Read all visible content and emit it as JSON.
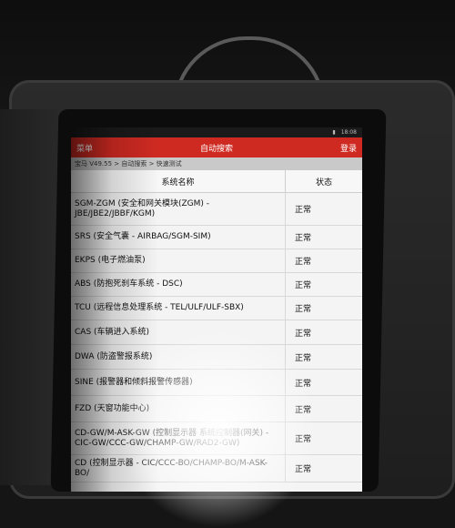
{
  "header": {
    "menu_label": "菜单",
    "title": "自动搜索",
    "login_label": "登录"
  },
  "statusbar": {
    "time": "18:08"
  },
  "breadcrumb": "宝马 V49.55 > 自动搜索 > 快速测试",
  "table": {
    "columns": [
      "系统名称",
      "状态"
    ],
    "rows": [
      {
        "name": "SGM-ZGM (安全和网关模块(ZGM) - JBE/JBE2/JBBF/KGM)",
        "status": "正常"
      },
      {
        "name": "SRS (安全气囊 - AIRBAG/SGM-SIM)",
        "status": "正常"
      },
      {
        "name": "EKPS (电子燃油泵)",
        "status": "正常"
      },
      {
        "name": "ABS (防抱死刹车系统 - DSC)",
        "status": "正常"
      },
      {
        "name": "TCU (远程信息处理系统 - TEL/ULF/ULF-SBX)",
        "status": "正常"
      },
      {
        "name": "CAS (车辆进入系统)",
        "status": "正常"
      },
      {
        "name": "DWA (防盗警报系统)",
        "status": "正常"
      },
      {
        "name": "SINE (报警器和倾斜报警传感器)",
        "status": "正常"
      },
      {
        "name": "FZD (天窗功能中心)",
        "status": "正常"
      },
      {
        "name": "CD-GW/M-ASK-GW (控制显示器 系统控制器(网关) - CIC-GW/CCC-GW/CHAMP-GW/RAD2-GW)",
        "status": "正常"
      },
      {
        "name": "CD (控制显示器 - CIC/CCC-BO/CHAMP-BO/M-ASK-BO/",
        "status": "正常"
      }
    ]
  }
}
